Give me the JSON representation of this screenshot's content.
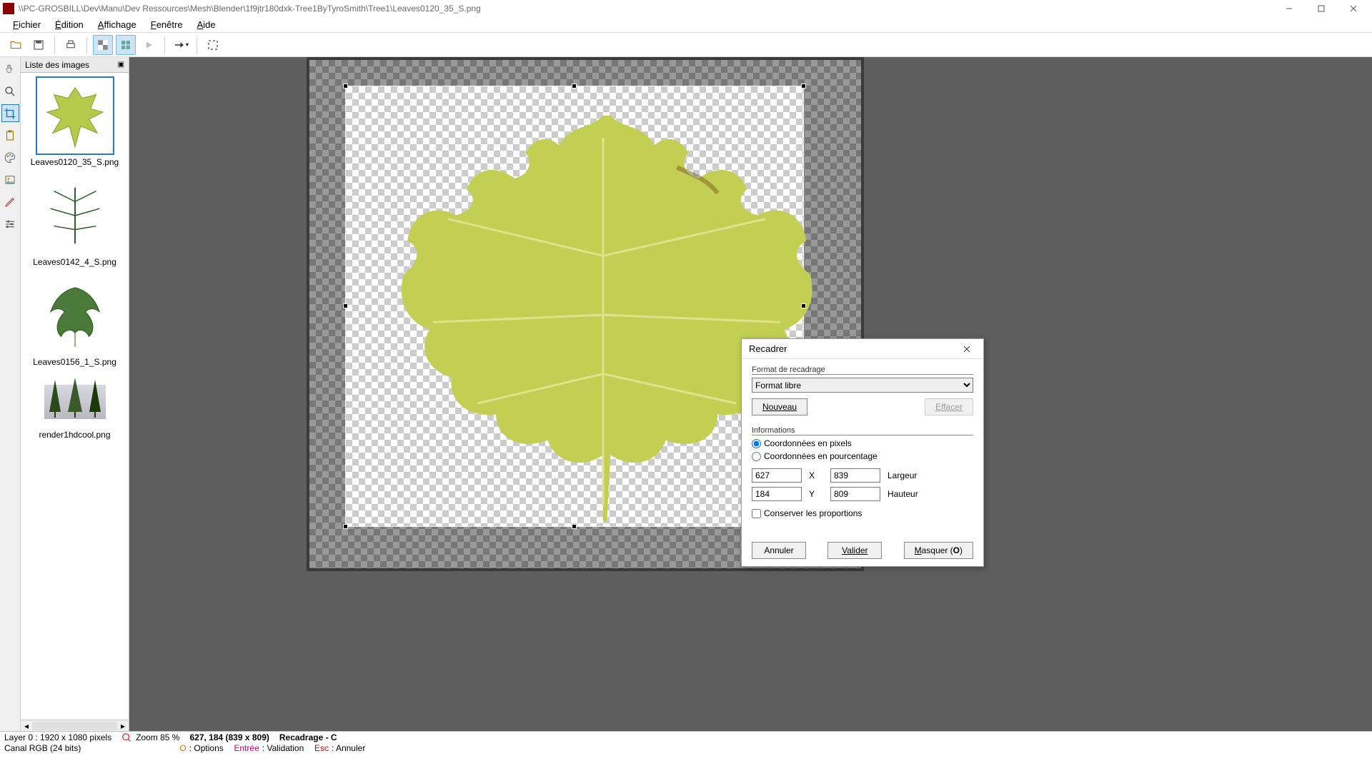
{
  "window": {
    "title": "\\\\PC-GROSBILL\\Dev\\Manu\\Dev Ressources\\Mesh\\Blender\\1f9jtr180dxk-Tree1ByTyroSmith\\Tree1\\Leaves0120_35_S.png"
  },
  "menu": {
    "items": [
      "Fichier",
      "Édition",
      "Affichage",
      "Fenêtre",
      "Aide"
    ]
  },
  "thumb_panel": {
    "title": "Liste des images",
    "items": [
      {
        "label": "Leaves0120_35_S.png",
        "selected": true
      },
      {
        "label": "Leaves0142_4_S.png",
        "selected": false
      },
      {
        "label": "Leaves0156_1_S.png",
        "selected": false
      },
      {
        "label": "render1hdcool.png",
        "selected": false
      }
    ]
  },
  "crop_dialog": {
    "title": "Recadrer",
    "sections": {
      "format": "Format de recadrage",
      "info": "Informations"
    },
    "format_value": "Format libre",
    "btn_new": "Nouveau",
    "btn_clear": "Effacer",
    "coord_px": "Coordonnées en pixels",
    "coord_pct": "Coordonnées en pourcentage",
    "x": "627",
    "y": "184",
    "w": "839",
    "h": "809",
    "lbl_x": "X",
    "lbl_y": "Y",
    "lbl_w": "Largeur",
    "lbl_h": "Hauteur",
    "keep_ratio": "Conserver les proportions",
    "btn_cancel": "Annuler",
    "btn_ok": "Valider",
    "btn_hide": "Masquer (O)"
  },
  "status": {
    "layer": "Layer 0 : 1920 x 1080 pixels",
    "zoom": "Zoom 85 %",
    "pos": "627, 184 (839 x 809)",
    "tool": "Recadrage - C",
    "channel": "Canal RGB (24 bits)",
    "k_o": "O",
    "k_o_txt": ": Options",
    "k_e": "Entrée",
    "k_e_txt": ": Validation",
    "k_esc": "Esc",
    "k_esc_txt": ": Annuler"
  }
}
